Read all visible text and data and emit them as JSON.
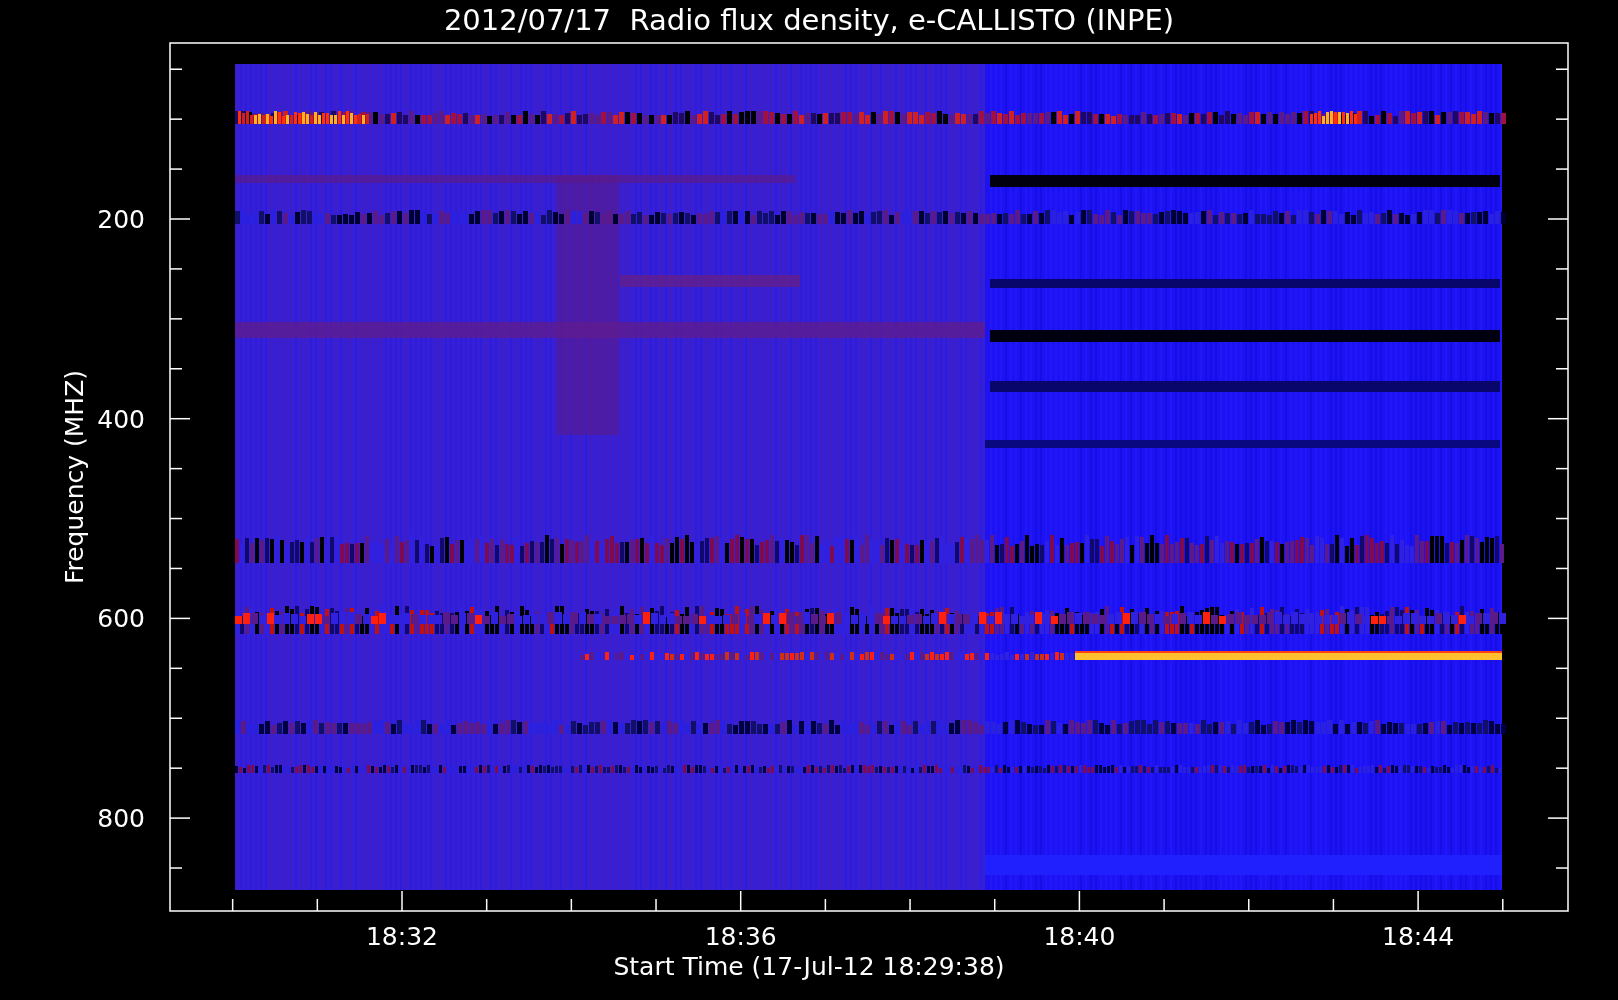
{
  "title": "2012/07/17  Radio flux density, e-CALLISTO (INPE)",
  "y_axis": {
    "label": "Frequency (MHZ)",
    "ticks": [
      "200",
      "400",
      "600",
      "800"
    ]
  },
  "x_axis": {
    "label": "Start Time (17-Jul-12 18:29:38)",
    "ticks": [
      "18:32",
      "18:36",
      "18:40",
      "18:44"
    ]
  }
}
